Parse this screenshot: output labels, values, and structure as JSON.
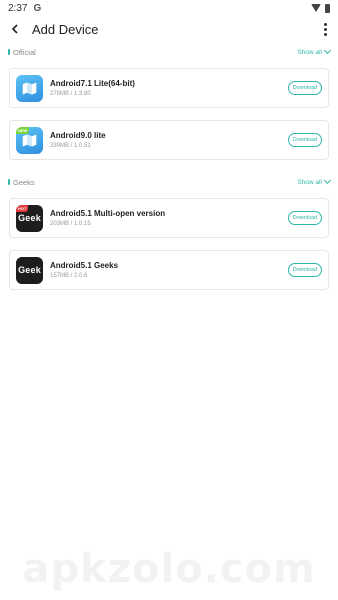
{
  "status_bar": {
    "time": "2:37",
    "google_glyph": "G"
  },
  "app_bar": {
    "title": "Add Device"
  },
  "sections": [
    {
      "label": "Official",
      "show_all": "Show all",
      "items": [
        {
          "name": "Android7.1 Lite(64-bit)",
          "meta": "278MB / 1.3.80",
          "button": "Download",
          "icon": "android-map-icon",
          "badge": ""
        },
        {
          "name": "Android9.0 lite",
          "meta": "339MB / 1.0.51",
          "button": "Download",
          "icon": "android-map-icon",
          "badge": "NEW"
        }
      ]
    },
    {
      "label": "Geeks",
      "show_all": "Show all",
      "items": [
        {
          "name": "Android5.1 Multi-open version",
          "meta": "203MB / 1.0.15",
          "button": "Download",
          "icon": "geek-icon",
          "icon_text": "Geek",
          "badge": "HOT"
        },
        {
          "name": "Android5.1 Geeks",
          "meta": "157MB / 2.0.6",
          "button": "Download",
          "icon": "geek-icon",
          "icon_text": "Geek",
          "badge": ""
        }
      ]
    }
  ],
  "watermark": "apkzolo.com",
  "colors": {
    "accent": "#2fb7a9",
    "icon_blue": "#3b9be8",
    "geek_bg": "#1d1d1d"
  }
}
